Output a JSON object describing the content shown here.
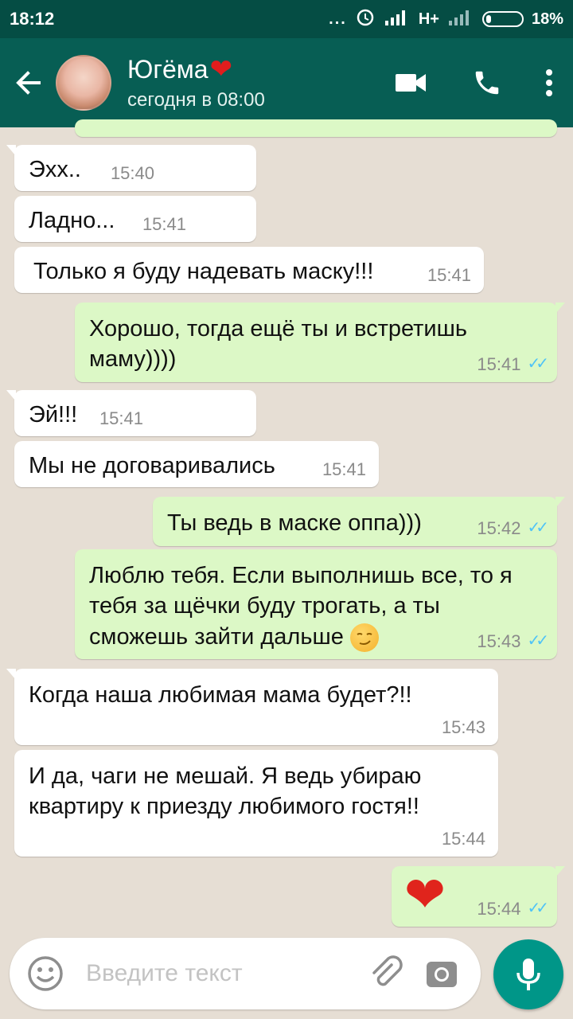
{
  "status_bar": {
    "time": "18:12",
    "dots": "...",
    "network": "H+",
    "battery": "18%"
  },
  "header": {
    "contact_name": "Югёма",
    "name_emoji": "❤️",
    "last_seen": "сегодня в 08:00",
    "icons": [
      "back-arrow-icon",
      "video-call-icon",
      "phone-icon",
      "more-vert-icon"
    ]
  },
  "messages": [
    {
      "dir": "in",
      "text": "Эхх..",
      "time": "15:40"
    },
    {
      "dir": "in",
      "text": "Ладно...",
      "time": "15:41"
    },
    {
      "dir": "in",
      "text": "Только я буду надевать маску!!!",
      "time": "15:41"
    },
    {
      "dir": "out",
      "text": "Хорошо, тогда ещё ты и встретишь маму))))",
      "time": "15:41",
      "read": true
    },
    {
      "dir": "in",
      "text": "Эй!!!",
      "time": "15:41"
    },
    {
      "dir": "in",
      "text": "Мы не договаривались",
      "time": "15:41"
    },
    {
      "dir": "out",
      "text": "Ты ведь в маске оппа)))",
      "time": "15:42",
      "read": true
    },
    {
      "dir": "out",
      "text": "Люблю тебя. Если выполнишь все, то я тебя за щёчки буду трогать, а ты сможешь зайти дальше",
      "emoji": "smirk-emoji",
      "time": "15:43",
      "read": true
    },
    {
      "dir": "in",
      "text": "Когда наша любимая мама будет?!!",
      "time": "15:43"
    },
    {
      "dir": "in",
      "text": "И да, чаги не мешай. Я ведь убираю квартиру к приезду любимого гостя!!",
      "time": "15:44"
    },
    {
      "dir": "out",
      "text": "❤️",
      "time": "15:44",
      "read": true
    }
  ],
  "input": {
    "placeholder": "Введите текст",
    "icons": [
      "emoji-icon",
      "attach-icon",
      "camera-icon",
      "mic-icon"
    ]
  },
  "colors": {
    "header": "#075e54",
    "statusbar": "#054d44",
    "incoming": "#ffffff",
    "outgoing": "#dcf8c6",
    "read_ticks": "#4fc3f7",
    "mic_button": "#009688"
  }
}
